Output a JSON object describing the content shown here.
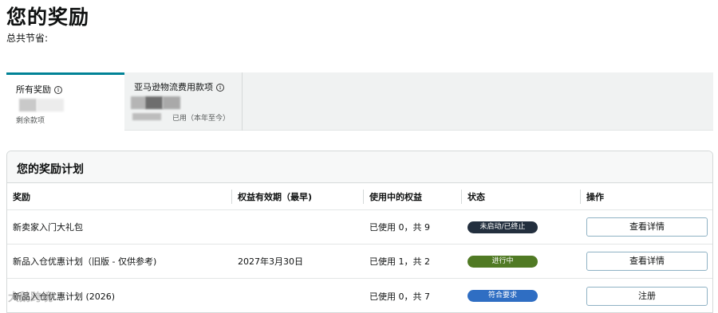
{
  "page": {
    "title": "您的奖励",
    "savings_label": "总共节省:"
  },
  "tabs": [
    {
      "title": "所有奖励",
      "subtitle": "剩余款项"
    },
    {
      "title": "亚马逊物流费用款项",
      "subtitle": "已用（本年至今）"
    }
  ],
  "card": {
    "title": "您的奖励计划",
    "columns": {
      "reward": "奖励",
      "expiry": "权益有效期（最早)",
      "used": "使用中的权益",
      "status": "状态",
      "action": "操作"
    },
    "rows": [
      {
        "reward": "新卖家入门大礼包",
        "expiry": "",
        "used": "已使用 0，共 9",
        "status": "未启动/已终止",
        "status_color": "#232f3e",
        "action": "查看详情"
      },
      {
        "reward": "新品入仓优惠计划（旧版 - 仅供参考)",
        "expiry": "2027年3月30日",
        "used": "已使用 1，共 2",
        "status": "进行中",
        "status_color": "#507a24",
        "action": "查看详情"
      },
      {
        "reward": "新品入仓优惠计划 (2026)",
        "expiry": "",
        "used": "已使用 0，共 7",
        "status": "符合要求",
        "status_color": "#2f6ec3",
        "action": "注册"
      }
    ]
  },
  "colors": {
    "tab_accent": "#008296",
    "button_border": "#8fb2c4"
  },
  "watermark": "大鹅跨境"
}
